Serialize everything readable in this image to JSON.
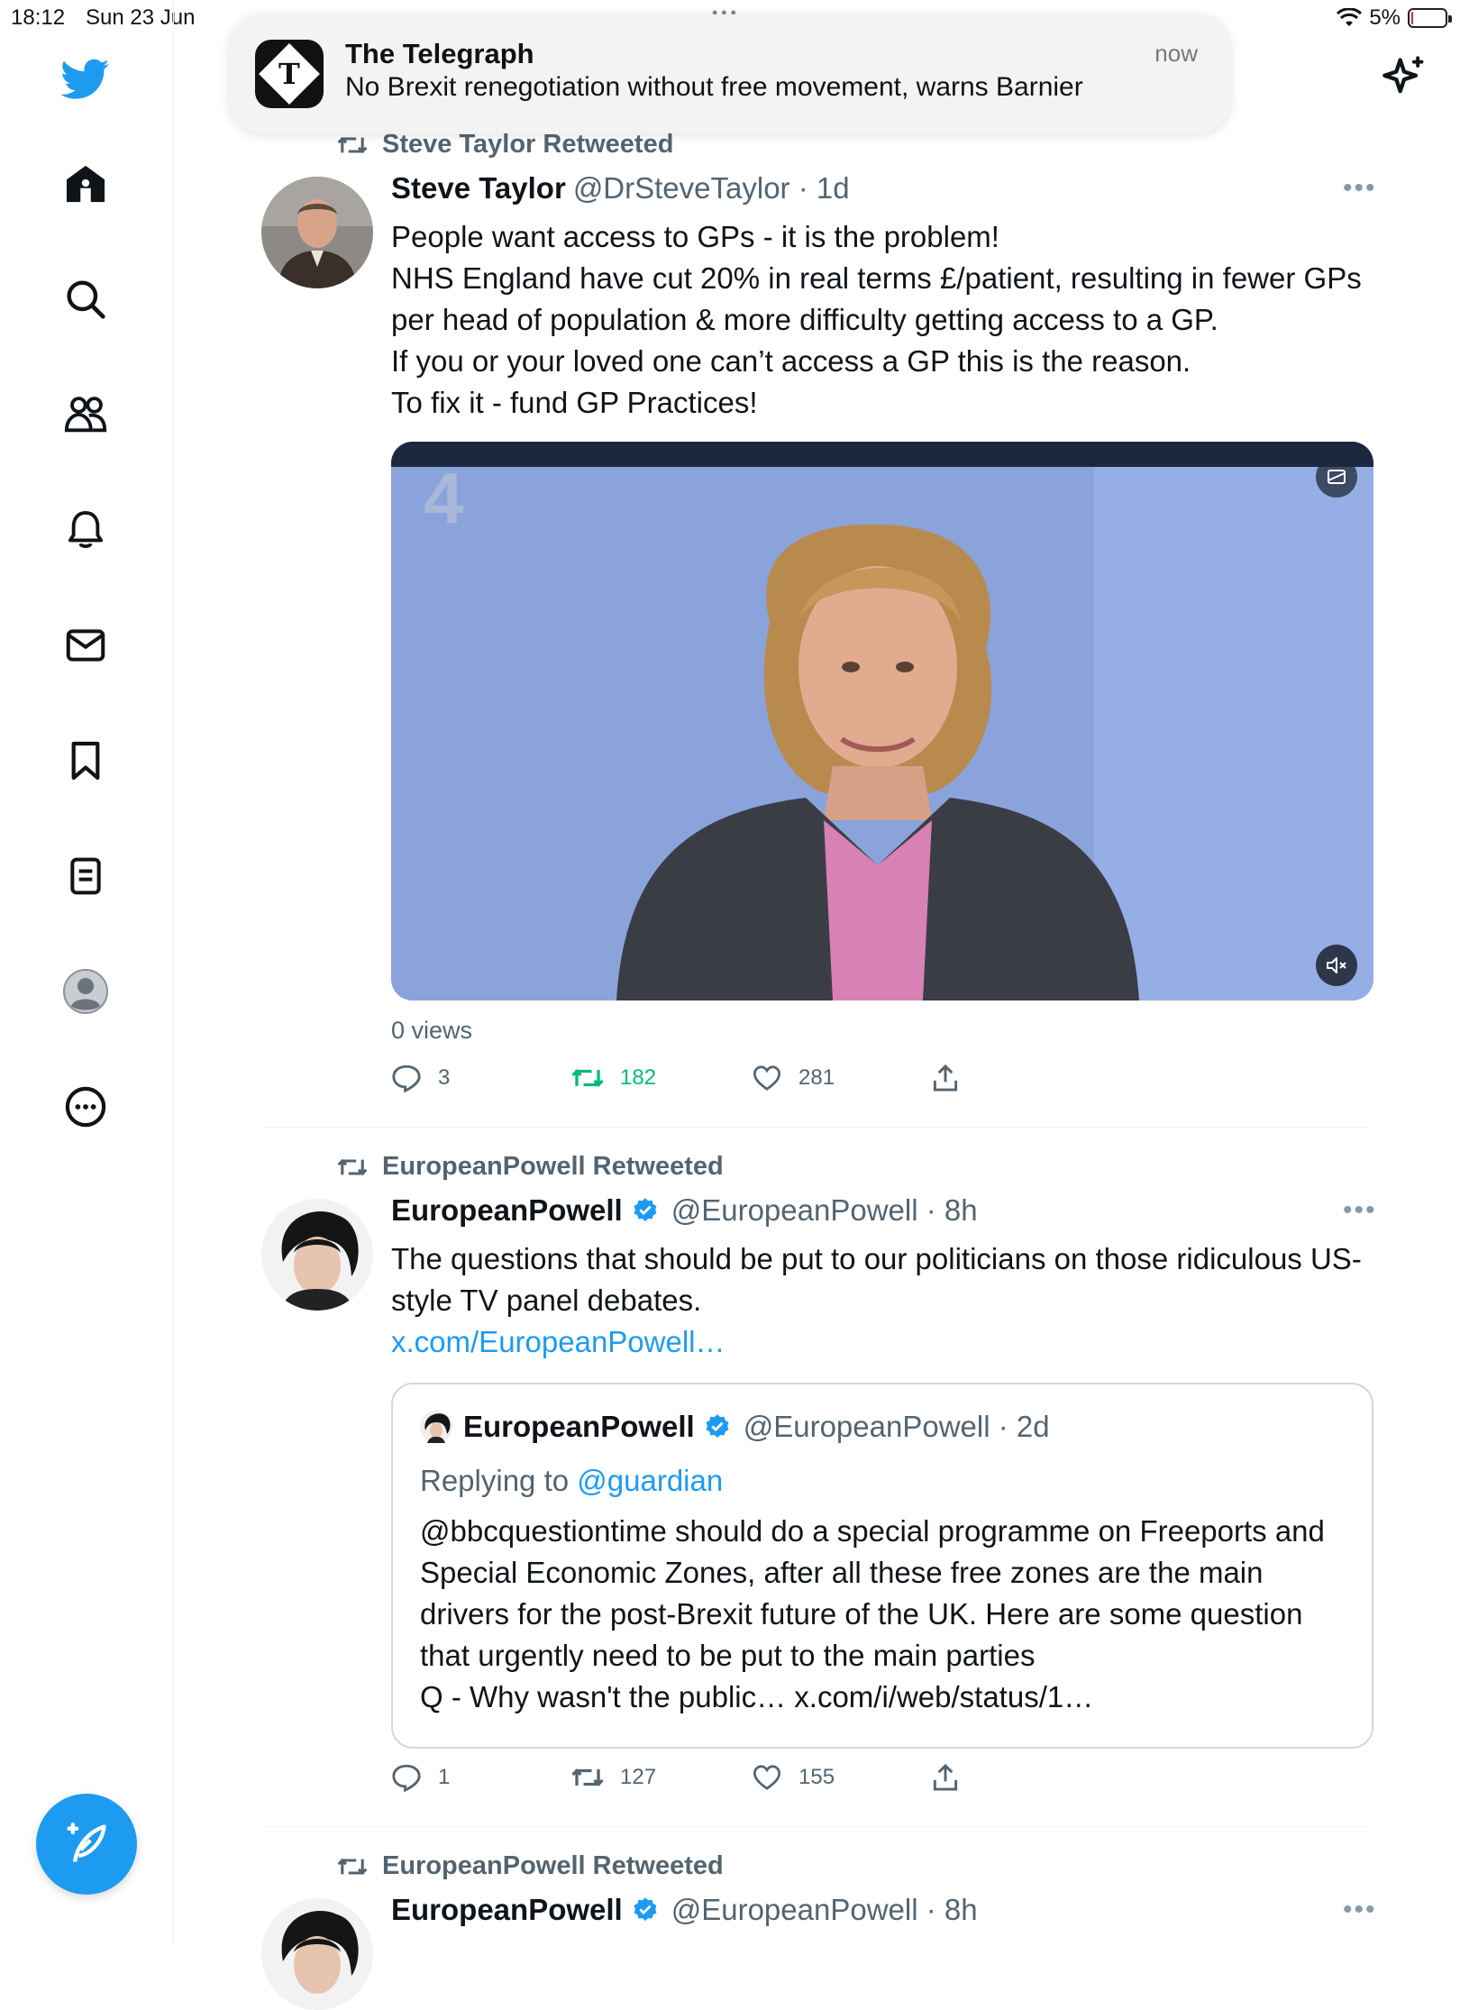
{
  "status_bar": {
    "time": "18:12",
    "date": "Sun 23 Jun",
    "battery": "5%",
    "battery_level": 0.05
  },
  "notification": {
    "app": "The Telegraph",
    "body": "No Brexit renegotiation without free movement, warns Barnier",
    "time": "now",
    "icon_letter": "T"
  },
  "sidebar": {
    "items": [
      {
        "icon": "home-icon"
      },
      {
        "icon": "search-icon"
      },
      {
        "icon": "communities-icon"
      },
      {
        "icon": "bell-icon"
      },
      {
        "icon": "mail-icon"
      },
      {
        "icon": "bookmark-icon"
      },
      {
        "icon": "lists-icon"
      },
      {
        "icon": "profile-icon"
      },
      {
        "icon": "more-circle-icon"
      }
    ],
    "compose_icon": "compose-icon"
  },
  "colors": {
    "accent": "#1d9bf0",
    "retweet_green": "#00ba7c",
    "muted": "#536471"
  },
  "tweets": [
    {
      "retweeted_by": "Steve Taylor Retweeted",
      "name": "Steve Taylor",
      "handle": "@DrSteveTaylor · 1d",
      "text": "People want access to GPs - it is the problem!\nNHS England have cut 20% in real terms £/patient, resulting in fewer GPs per head of population & more difficulty getting access to a GP.\nIf you or your loved one can’t access a GP this is the reason.\nTo fix it - fund GP Practices!",
      "views": "0 views",
      "replies": "3",
      "retweets": "182",
      "likes": "281",
      "media_watermark": "4"
    },
    {
      "retweeted_by": "EuropeanPowell Retweeted",
      "name": "EuropeanPowell",
      "handle": "@EuropeanPowell · 8h",
      "text": "The questions that should be put to our politicians on those ridiculous US-style TV panel debates.",
      "link": "x.com/EuropeanPowell…",
      "quote": {
        "name": "EuropeanPowell",
        "handle": "@EuropeanPowell · 2d",
        "replying_prefix": "Replying to ",
        "replying_to": "@guardian",
        "text": "@bbcquestiontime should do a special programme on Freeports and Special Economic Zones, after all these free zones are the main drivers for the post-Brexit future of the UK. Here are some question that urgently need to be put to the main parties\nQ - Why wasn't the public… x.com/i/web/status/1…"
      },
      "replies": "1",
      "retweets": "127",
      "likes": "155"
    },
    {
      "retweeted_by": "EuropeanPowell Retweeted",
      "name": "EuropeanPowell",
      "handle": "@EuropeanPowell · 8h"
    }
  ]
}
